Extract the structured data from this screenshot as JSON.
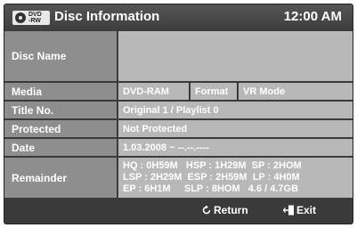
{
  "header": {
    "icon_line1": "DVD",
    "icon_line2": "-RW",
    "title": "Disc Information",
    "clock": "12:00 AM"
  },
  "rows": {
    "disc_name": {
      "label": "Disc Name",
      "value": ""
    },
    "media": {
      "label": "Media",
      "value": "DVD-RAM",
      "format_label": "Format",
      "format_value": "VR Mode"
    },
    "title_no": {
      "label": "Title No.",
      "value": "Original 1 / Playlist 0"
    },
    "protected": {
      "label": "Protected",
      "value": "Not Protected"
    },
    "date": {
      "label": "Date",
      "value": "1.03.2008 ~ --.--.----"
    },
    "remainder": {
      "label": "Remainder",
      "line1": "HQ : 0H59M   HSP : 1H29M  SP : 2HOM",
      "line2": "LSP : 2H29M  ESP : 2H59M  LP : 4H0M",
      "line3": "EP : 6H1M     SLP : 8HOM   4.6 / 4.7GB"
    }
  },
  "footer": {
    "return_label": "Return",
    "exit_label": "Exit"
  }
}
